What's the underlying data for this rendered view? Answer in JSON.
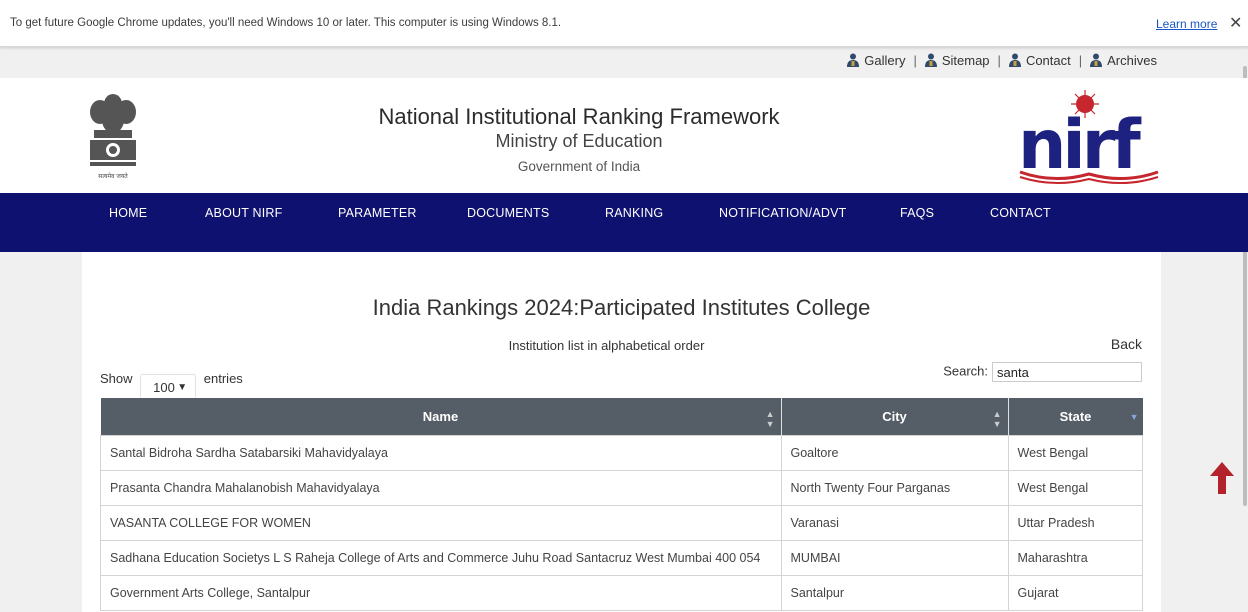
{
  "infobar": {
    "message": "To get future Google Chrome updates, you'll need Windows 10 or later. This computer is using Windows 8.1.",
    "learn_more": "Learn more",
    "close": "✕"
  },
  "top_links": [
    "Gallery",
    "Sitemap",
    "Contact",
    "Archives"
  ],
  "header": {
    "title": "National Institutional Ranking Framework",
    "ministry": "Ministry of Education",
    "government": "Government of India",
    "emblem_text": "सत्यमेव जयते"
  },
  "nav": [
    "HOME",
    "ABOUT NIRF",
    "PARAMETER",
    "DOCUMENTS",
    "RANKING",
    "NOTIFICATION/ADVT",
    "FAQS",
    "CONTACT"
  ],
  "page": {
    "title": "India Rankings 2024:Participated Institutes College",
    "subtitle": "Institution list in alphabetical order",
    "back": "Back"
  },
  "controls": {
    "show_label": "Show",
    "entries_value": "100",
    "entries_label": "entries",
    "search_label": "Search:",
    "search_value": "santa"
  },
  "table": {
    "columns": [
      "Name",
      "City",
      "State"
    ],
    "rows": [
      [
        "Santal Bidroha Sardha Satabarsiki Mahavidyalaya",
        "Goaltore",
        "West Bengal"
      ],
      [
        "Prasanta Chandra Mahalanobish Mahavidyalaya",
        "North Twenty Four Parganas",
        "West Bengal"
      ],
      [
        "VASANTA COLLEGE FOR WOMEN",
        "Varanasi",
        "Uttar Pradesh"
      ],
      [
        "Sadhana Education Societys L S Raheja College of Arts and Commerce Juhu Road Santacruz West Mumbai 400 054",
        "MUMBAI",
        "Maharashtra"
      ],
      [
        "Government Arts College, Santalpur",
        "Santalpur",
        "Gujarat"
      ]
    ]
  },
  "colors": {
    "nav_bg": "#0e1170",
    "table_header": "#555d66",
    "accent_red": "#b3232c",
    "link": "#1a56c8"
  }
}
